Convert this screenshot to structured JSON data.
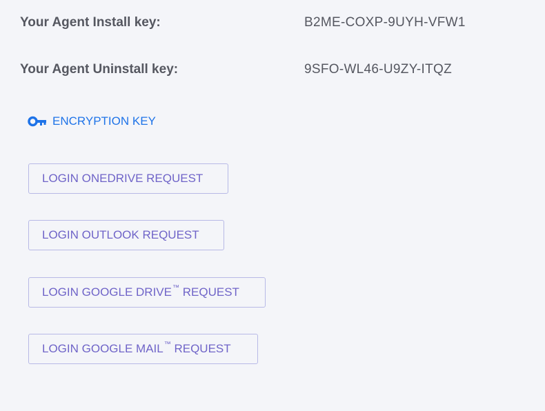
{
  "keys": {
    "install_label": "Your Agent Install key:",
    "install_value": "B2ME-COXP-9UYH-VFW1",
    "uninstall_label": "Your Agent Uninstall key:",
    "uninstall_value": "9SFO-WL46-U9ZY-ITQZ"
  },
  "encryption": {
    "label": "ENCRYPTION KEY",
    "icon": "key-icon",
    "color": "#1e73e8"
  },
  "buttons": {
    "onedrive": "LOGIN ONEDRIVE REQUEST",
    "outlook": "LOGIN OUTLOOK REQUEST",
    "gdrive_prefix": "LOGIN GOOGLE DRIVE",
    "gdrive_suffix": "REQUEST",
    "gmail_prefix": "LOGIN GOOGLE MAIL",
    "gmail_suffix": "REQUEST",
    "trademark": "™",
    "accent": "#6f64c8",
    "border": "#b7b9e6"
  }
}
